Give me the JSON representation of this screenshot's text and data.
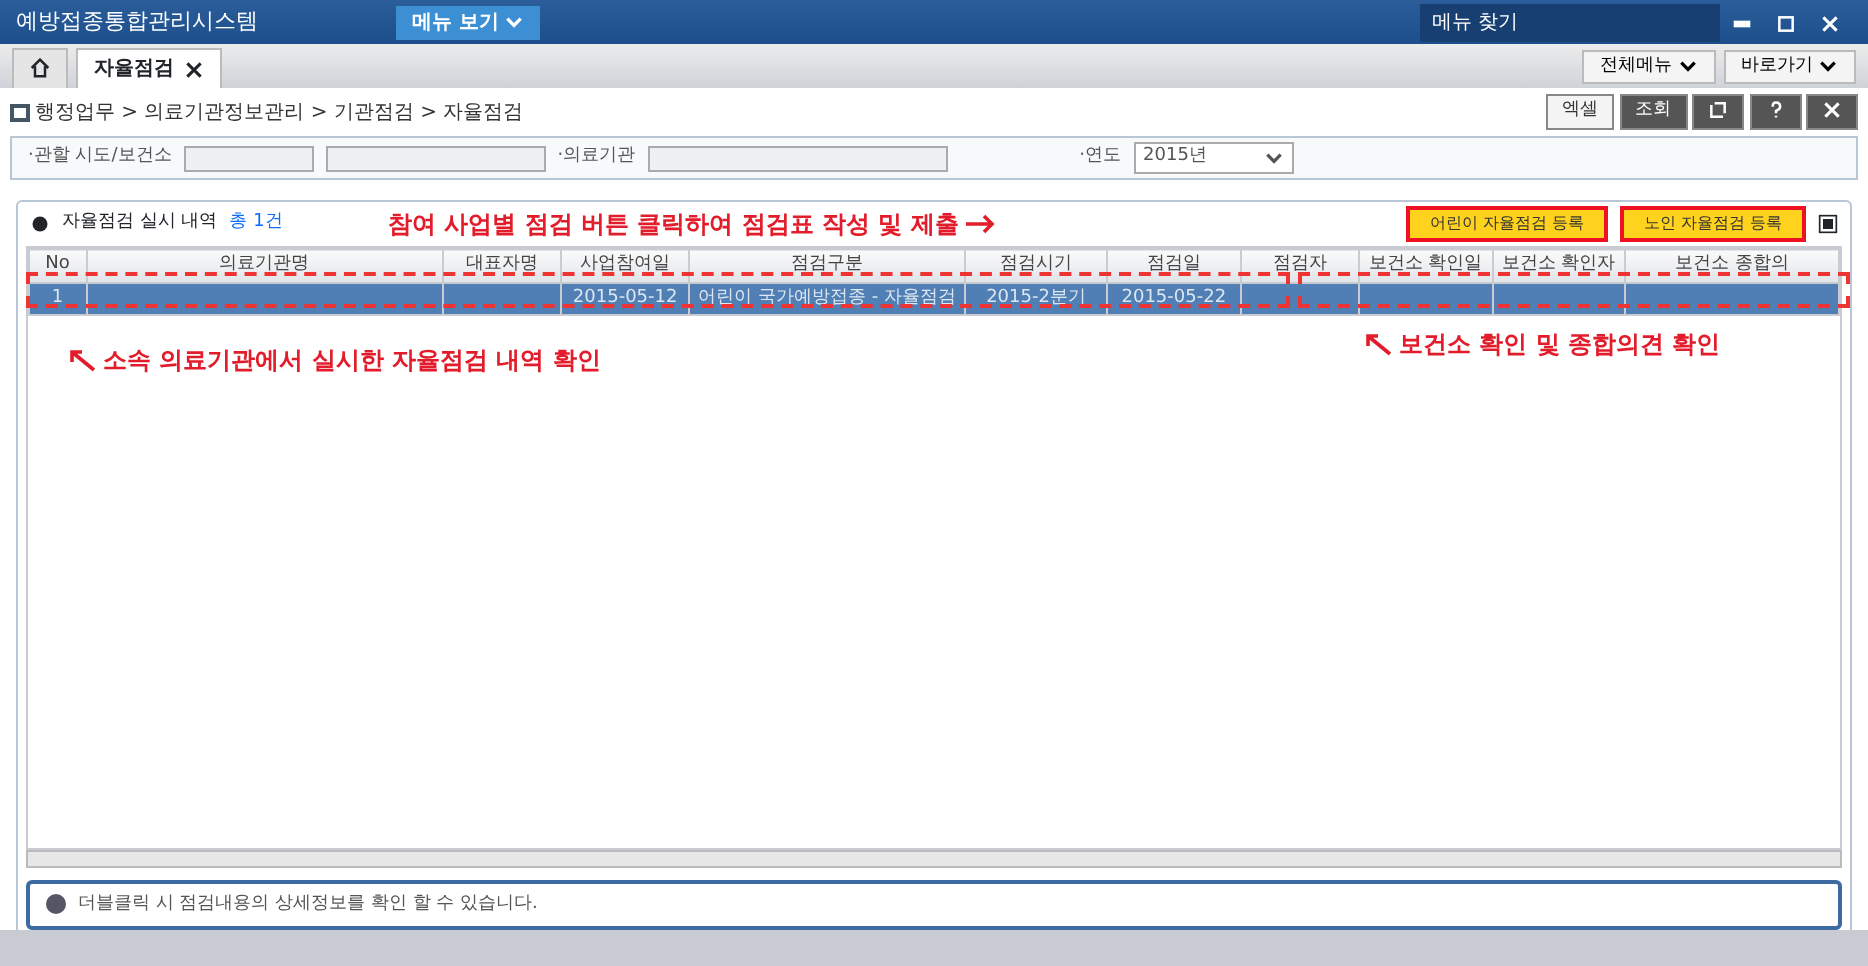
{
  "window": {
    "title": "예방접종통합관리시스템",
    "menu_button": "메뉴 보기",
    "menu_search": "메뉴 찾기"
  },
  "tabs": [
    {
      "label": "자율점검",
      "selected": true
    }
  ],
  "tab_tools": [
    "전체메뉴",
    "바로가기"
  ],
  "breadcrumb": "행정업무 > 의료기관정보관리 > 기관점검 > 자율점검",
  "actions": [
    "엑셀",
    "조회"
  ],
  "filters": [
    {
      "label": "·관할 시도/보건소",
      "kind": "selects"
    },
    {
      "label": "·의료기관",
      "kind": "input"
    },
    {
      "label": "·연도",
      "kind": "select",
      "value": "2015년"
    }
  ],
  "grid": {
    "title": "자율점검 실시 내역",
    "count": "총 1건",
    "buttons": [
      "어린이 자율점검 등록",
      "노인 자율점검 등록"
    ],
    "columns": [
      "No",
      "의료기관명",
      "대표자명",
      "사업참여일",
      "점검구분",
      "점검시기",
      "점검일",
      "점검자",
      "보건소 확인일",
      "보건소 확인자",
      "보건소 종합의"
    ],
    "rows": [
      {
        "selected": true,
        "cells": [
          "1",
          "",
          "",
          "2015-05-12",
          "어린이 국가예방접종 - 자율점검",
          "2015-2분기",
          "2015-05-22",
          "",
          "",
          "",
          ""
        ]
      }
    ]
  },
  "annotations": [
    "참여 사업별 점검 버튼 클릭하여 점검표 작성 및 제출",
    "소속 의료기관에서 실시한 자율점검 내역 확인",
    "보건소 확인 및 종합의견 확인"
  ],
  "info": "더블클릭 시 점검내용의 상세정보를 확인 할 수 있습니다."
}
